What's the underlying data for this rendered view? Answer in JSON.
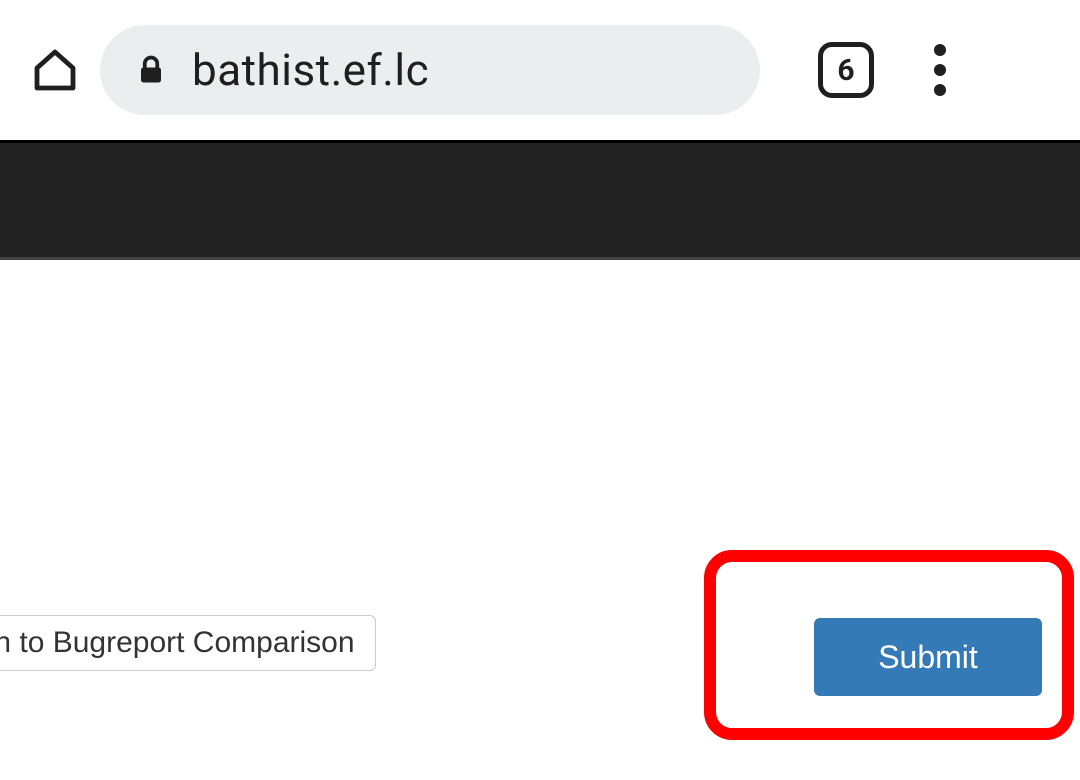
{
  "browser": {
    "url": "bathist.ef.lc",
    "tab_count": "6"
  },
  "page": {
    "switch_button_label": "tch to Bugreport Comparison",
    "submit_button_label": "Submit"
  }
}
